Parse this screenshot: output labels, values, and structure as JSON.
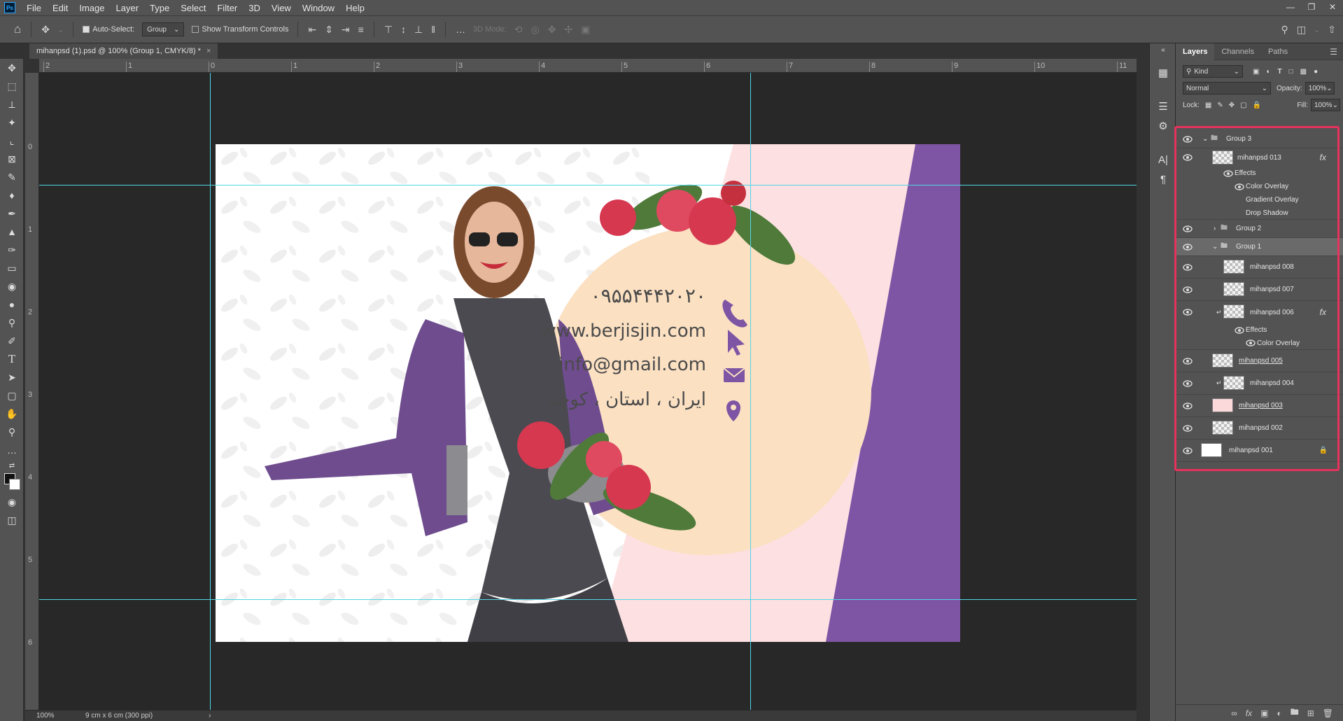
{
  "app": {
    "logo": "Ps"
  },
  "menu": [
    "File",
    "Edit",
    "Image",
    "Layer",
    "Type",
    "Select",
    "Filter",
    "3D",
    "View",
    "Window",
    "Help"
  ],
  "window_controls": [
    "minimize",
    "restore",
    "close"
  ],
  "options": {
    "auto_select_label": "Auto-Select:",
    "auto_select_checked": true,
    "auto_select_value": "Group",
    "transform_label": "Show Transform Controls",
    "transform_checked": false,
    "mode_3d_label": "3D Mode:"
  },
  "document_tab": {
    "title": "mihanpsd (1).psd @ 100% (Group 1, CMYK/8) *",
    "close": "×"
  },
  "rulers": {
    "horizontal": [
      "2",
      "1",
      "0",
      "1",
      "2",
      "3",
      "4",
      "5",
      "6",
      "7",
      "8",
      "9",
      "10",
      "11"
    ],
    "vertical": [
      "0",
      "1",
      "2",
      "3",
      "4",
      "5",
      "6"
    ]
  },
  "card": {
    "phone": "۰۹۵۵۴۴۴۲۰۲۰",
    "website": "www.berjisjin.com",
    "email": "info@gmail.com",
    "address": "ایران ، استان ، کوچه",
    "colors": {
      "pink": "#fde0e2",
      "purple": "#7e55a4",
      "circle": "#fbe0c2",
      "icon": "#7e55a4"
    }
  },
  "status": {
    "zoom": "100%",
    "doc_size": "9 cm x 6 cm (300 ppi)",
    "arrow": "›"
  },
  "panel": {
    "tabs": [
      "Layers",
      "Channels",
      "Paths"
    ],
    "filter_kind": "Kind",
    "blend_mode": "Normal",
    "opacity_label": "Opacity:",
    "opacity_value": "100%",
    "lock_label": "Lock:",
    "fill_label": "Fill:",
    "fill_value": "100%"
  },
  "layers": {
    "group3": "Group 3",
    "l013": "mihanpsd 013",
    "effects1": "Effects",
    "color_overlay1": "Color Overlay",
    "gradient_overlay": "Gradient Overlay",
    "drop_shadow": "Drop Shadow",
    "group2": "Group 2",
    "group1": "Group 1",
    "l008": "mihanpsd 008",
    "l007": "mihanpsd 007",
    "l006": "mihanpsd 006",
    "effects2": "Effects",
    "color_overlay2": "Color Overlay",
    "l005": "mihanpsd 005",
    "l004": "mihanpsd 004",
    "l003": "mihanpsd 003",
    "l002": "mihanpsd 002",
    "l001": "mihanpsd 001",
    "fx": "fx"
  }
}
